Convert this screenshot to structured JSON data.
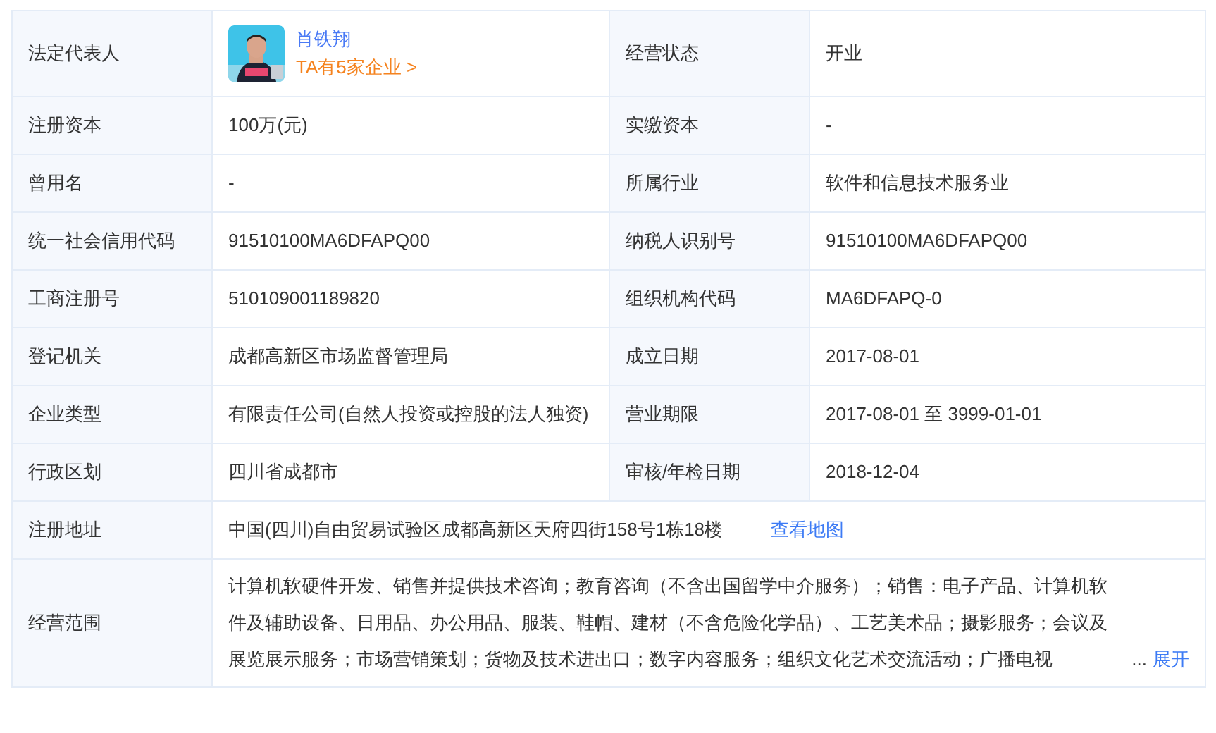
{
  "rows": [
    {
      "cells": [
        {
          "label": "法定代表人",
          "kind": "person",
          "name": "肖铁翔",
          "link": "TA有5家企业 >"
        },
        {
          "label": "经营状态",
          "kind": "text",
          "value": "开业"
        }
      ]
    },
    {
      "cells": [
        {
          "label": "注册资本",
          "kind": "text",
          "value": "100万(元)"
        },
        {
          "label": "实缴资本",
          "kind": "text",
          "value": "-"
        }
      ]
    },
    {
      "cells": [
        {
          "label": "曾用名",
          "kind": "text",
          "value": "-"
        },
        {
          "label": "所属行业",
          "kind": "text",
          "value": "软件和信息技术服务业"
        }
      ]
    },
    {
      "cells": [
        {
          "label": "统一社会信用代码",
          "kind": "text",
          "value": "91510100MA6DFAPQ00"
        },
        {
          "label": "纳税人识别号",
          "kind": "text",
          "value": "91510100MA6DFAPQ00"
        }
      ]
    },
    {
      "cells": [
        {
          "label": "工商注册号",
          "kind": "text",
          "value": "510109001189820"
        },
        {
          "label": "组织机构代码",
          "kind": "text",
          "value": "MA6DFAPQ-0"
        }
      ]
    },
    {
      "cells": [
        {
          "label": "登记机关",
          "kind": "text",
          "value": "成都高新区市场监督管理局"
        },
        {
          "label": "成立日期",
          "kind": "text",
          "value": "2017-08-01"
        }
      ]
    },
    {
      "cells": [
        {
          "label": "企业类型",
          "kind": "text",
          "value": "有限责任公司(自然人投资或控股的法人独资)"
        },
        {
          "label": "营业期限",
          "kind": "text",
          "value": "2017-08-01 至 3999-01-01"
        }
      ]
    },
    {
      "cells": [
        {
          "label": "行政区划",
          "kind": "text",
          "value": "四川省成都市"
        },
        {
          "label": "审核/年检日期",
          "kind": "text",
          "value": "2018-12-04"
        }
      ]
    },
    {
      "cells": [
        {
          "label": "注册地址",
          "kind": "address",
          "value": "中国(四川)自由贸易试验区成都高新区天府四街158号1栋18楼",
          "link": "查看地图"
        }
      ]
    },
    {
      "cells": [
        {
          "label": "经营范围",
          "kind": "scope",
          "value": "计算机软硬件开发、销售并提供技术咨询；教育咨询（不含出国留学中介服务）；销售：电子产品、计算机软件及辅助设备、日用品、办公用品、服装、鞋帽、建材（不含危险化学品）、工艺美术品；摄影服务；会议及展览展示服务；市场营销策划；货物及技术进出口；数字内容服务；组织文化艺术交流活动；广播电视",
          "ellipsis": "...",
          "link": "展开"
        }
      ]
    }
  ]
}
